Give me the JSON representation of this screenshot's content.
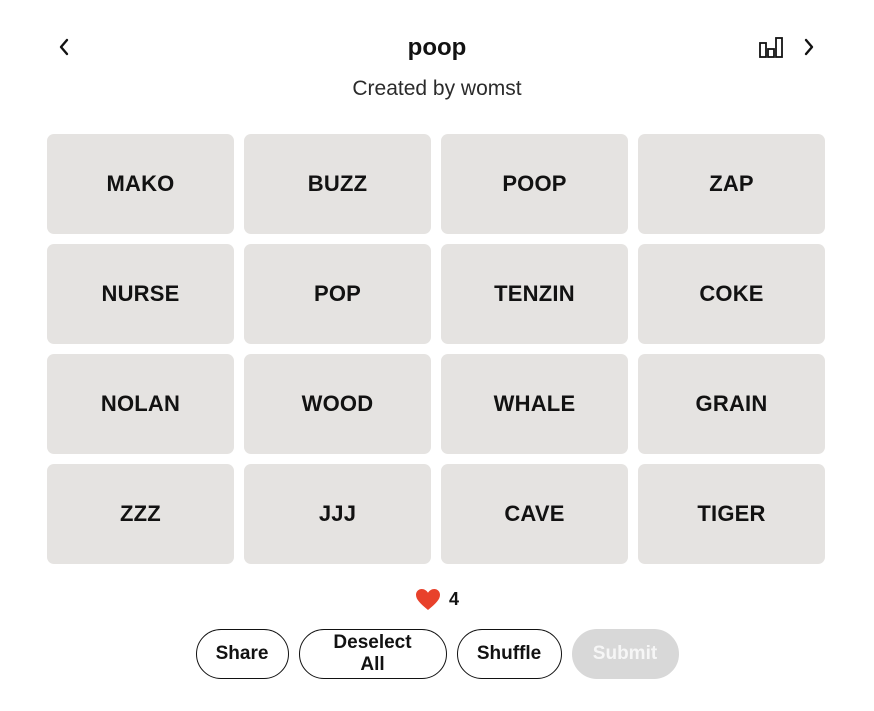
{
  "header": {
    "title": "poop",
    "subtitle": "Created by womst",
    "prev_icon": "chevron-left-icon",
    "next_icon": "chevron-right-icon",
    "stats_icon": "bar-chart-icon"
  },
  "board": {
    "tiles": [
      "MAKO",
      "BUZZ",
      "POOP",
      "ZAP",
      "NURSE",
      "POP",
      "TENZIN",
      "COKE",
      "NOLAN",
      "WOOD",
      "WHALE",
      "GRAIN",
      "ZZZ",
      "JJJ",
      "CAVE",
      "TIGER"
    ]
  },
  "mistakes": {
    "icon": "heart-icon",
    "count": "4",
    "heart_color": "#e8412b"
  },
  "controls": {
    "share_label": "Share",
    "deselect_label": "Deselect All",
    "shuffle_label": "Shuffle",
    "submit_label": "Submit",
    "submit_enabled": false
  },
  "colors": {
    "tile_bg": "#e5e3e1",
    "text": "#121212",
    "submit_disabled_bg": "#d8d8d8"
  }
}
